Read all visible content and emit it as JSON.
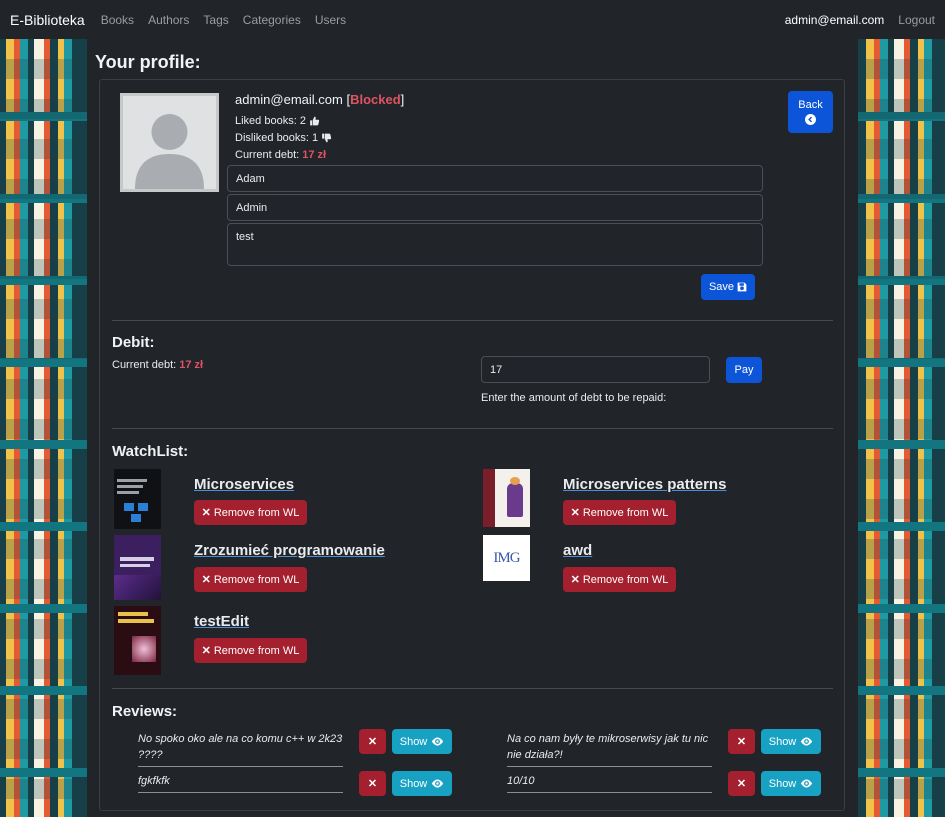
{
  "navbar": {
    "brand": "E-Biblioteka",
    "links": [
      "Books",
      "Authors",
      "Tags",
      "Categories",
      "Users"
    ],
    "user": "admin@email.com",
    "logout": "Logout"
  },
  "page": {
    "title": "Your profile:"
  },
  "profile": {
    "email": "admin@email.com",
    "status": "Blocked",
    "liked_label": "Liked books: 2",
    "disliked_label": "Disliked books: 1",
    "debt_label": "Current debt:",
    "debt_value": "17 zł",
    "first_name": "Adam",
    "last_name": "Admin",
    "bio": "test",
    "save_label": "Save",
    "back_label": "Back"
  },
  "debit": {
    "title": "Debit:",
    "current_label": "Current debt:",
    "current_value": "17 zł",
    "amount": "17",
    "pay_label": "Pay",
    "hint": "Enter the amount of debt to be repaid:"
  },
  "watchlist": {
    "title": "WatchList:",
    "remove_label": "Remove from WL",
    "items": [
      {
        "title": "Microservices"
      },
      {
        "title": "Microservices patterns"
      },
      {
        "title": "Zrozumieć programowanie"
      },
      {
        "title": "awd"
      },
      {
        "title": "testEdit"
      }
    ]
  },
  "reviews": {
    "title": "Reviews:",
    "show_label": "Show",
    "items": [
      {
        "text": "No spoko oko ale na co komu c++ w 2k23 ????"
      },
      {
        "text": "Na co nam były te mikroserwisy jak tu nic nie działa?!"
      },
      {
        "text": "fgkfkfk"
      },
      {
        "text": "10/10"
      }
    ]
  },
  "colors": {
    "navbar": "#212529",
    "primary": "#0d55d8",
    "danger": "#a5202f",
    "info": "#17a2c4",
    "alert_text": "#e05263"
  }
}
